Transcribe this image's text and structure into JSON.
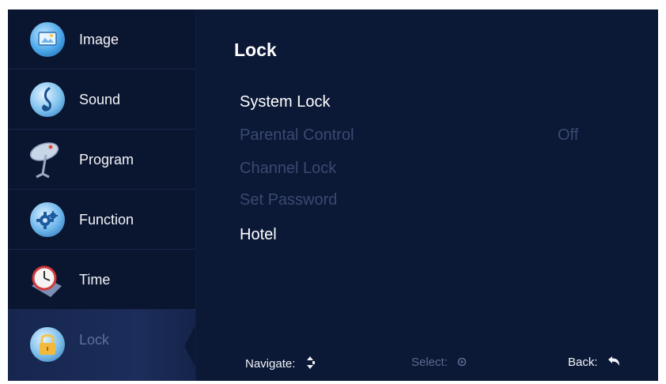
{
  "sidebar": {
    "items": [
      {
        "label": "Image",
        "icon": "image-icon"
      },
      {
        "label": "Sound",
        "icon": "music-note-icon"
      },
      {
        "label": "Program",
        "icon": "satellite-dish-icon"
      },
      {
        "label": "Function",
        "icon": "gear-icon"
      },
      {
        "label": "Time",
        "icon": "clock-icon"
      },
      {
        "label": "Lock",
        "icon": "padlock-icon",
        "active": true
      }
    ]
  },
  "main": {
    "title": "Lock",
    "items": [
      {
        "label": "System Lock",
        "enabled": true
      },
      {
        "label": "Parental Control",
        "value": "Off",
        "enabled": false
      },
      {
        "label": "Channel Lock",
        "enabled": false
      },
      {
        "label": "Set Password",
        "enabled": false
      },
      {
        "label": "Hotel",
        "enabled": true
      }
    ]
  },
  "footer": {
    "navigate": "Navigate:",
    "select": "Select:",
    "back": "Back:"
  },
  "colors": {
    "background": "#0b1836",
    "sidebar": "#0a1530",
    "text": "#ffffff",
    "disabled_text": "#3a4a70"
  }
}
